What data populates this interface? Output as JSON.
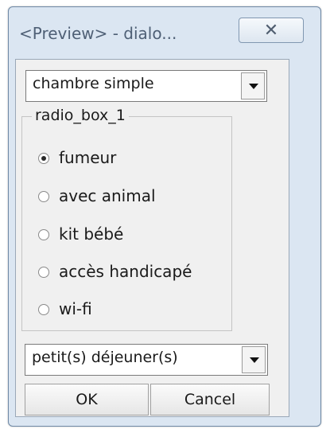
{
  "window": {
    "title": "<Preview> - dialo...",
    "close_glyph": "✕"
  },
  "room_combo": {
    "value": "chambre simple"
  },
  "radio_group": {
    "label": "radio_box_1",
    "options": [
      {
        "label": "fumeur",
        "selected": true
      },
      {
        "label": "avec animal",
        "selected": false
      },
      {
        "label": "kit bébé",
        "selected": false
      },
      {
        "label": "accès handicapé",
        "selected": false
      },
      {
        "label": "wi-fi",
        "selected": false
      }
    ]
  },
  "breakfast_combo": {
    "value": "petit(s) déjeuner(s)"
  },
  "buttons": {
    "ok": "OK",
    "cancel": "Cancel"
  }
}
